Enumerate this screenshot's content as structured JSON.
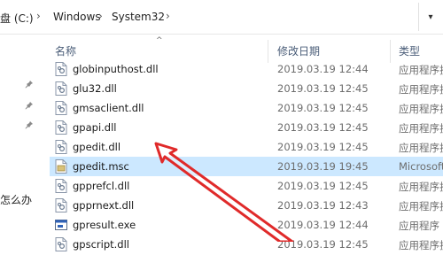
{
  "address": {
    "drive": "盘 (C:)",
    "folder1": "Windows",
    "folder2": "System32"
  },
  "nav": {
    "partial_text": "怎么办"
  },
  "columns": {
    "name": "名称",
    "date": "修改日期",
    "type": "类型"
  },
  "files": [
    {
      "name": "globinputhost.dll",
      "date": "2019.03.19 12:44",
      "type": "应用程序扩展",
      "icon": "dll-file-icon"
    },
    {
      "name": "glu32.dll",
      "date": "2019.03.19 12:45",
      "type": "应用程序扩展",
      "icon": "dll-file-icon"
    },
    {
      "name": "gmsaclient.dll",
      "date": "2019.03.19 12:45",
      "type": "应用程序扩展",
      "icon": "dll-file-icon"
    },
    {
      "name": "gpapi.dll",
      "date": "2019.03.19 12:45",
      "type": "应用程序扩展",
      "icon": "dll-file-icon"
    },
    {
      "name": "gpedit.dll",
      "date": "2019.03.19 12:45",
      "type": "应用程序扩展",
      "icon": "dll-file-icon"
    },
    {
      "name": "gpedit.msc",
      "date": "2019.03.19 19:45",
      "type": "Microsoft",
      "icon": "msc-file-icon",
      "selected": true
    },
    {
      "name": "gpprefcl.dll",
      "date": "2019.03.19 12:45",
      "type": "应用程序扩展",
      "icon": "dll-file-icon"
    },
    {
      "name": "gpprnext.dll",
      "date": "2019.03.19 12:43",
      "type": "应用程序扩展",
      "icon": "dll-file-icon"
    },
    {
      "name": "gpresult.exe",
      "date": "2019.03.19 12:44",
      "type": "应用程序",
      "icon": "exe-file-icon"
    },
    {
      "name": "gpscript.dll",
      "date": "2019.03.19 12:45",
      "type": "应用程序扩展",
      "icon": "dll-file-icon"
    }
  ],
  "colors": {
    "selected_row": "#cce8ff",
    "annotation_arrow": "#e02a2a",
    "header_text": "#4a5d78"
  }
}
